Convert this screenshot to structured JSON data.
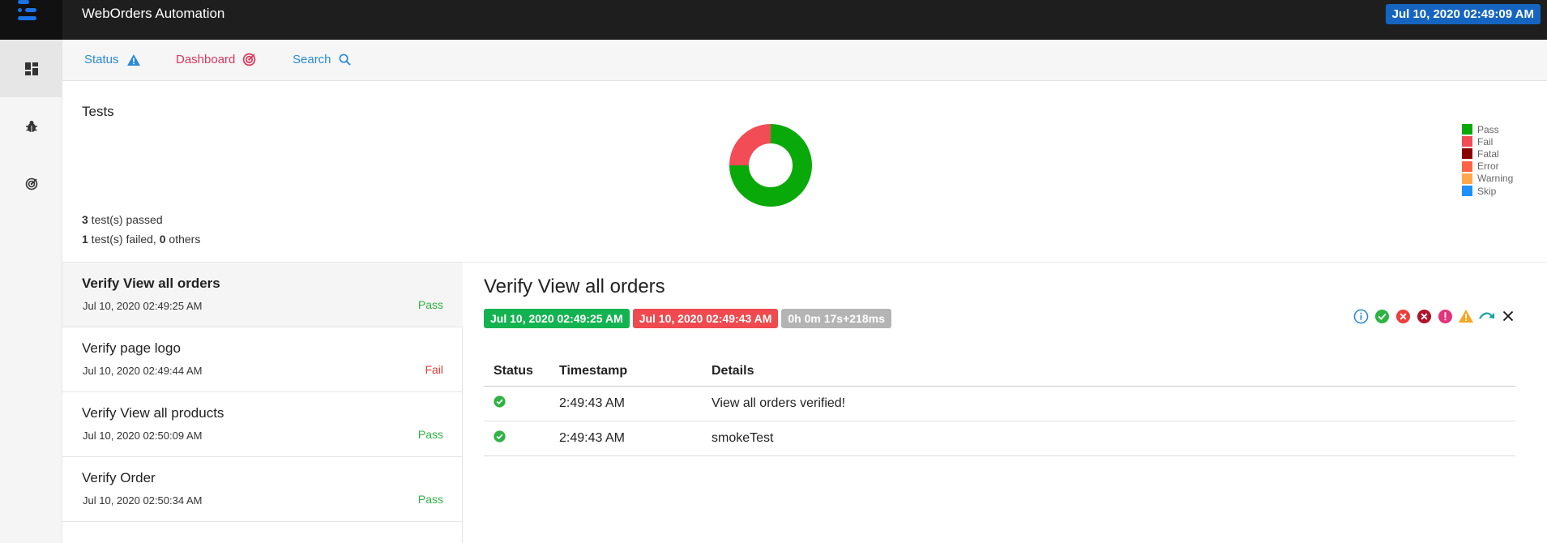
{
  "header": {
    "app_title": "WebOrders Automation",
    "datetime": "Jul 10, 2020 02:49:09 AM"
  },
  "sidebar": {
    "items": [
      {
        "icon": "dashboard-grid-icon"
      },
      {
        "icon": "bug-icon"
      },
      {
        "icon": "radar-icon"
      }
    ]
  },
  "nav": {
    "status_label": "Status",
    "dashboard_label": "Dashboard",
    "search_label": "Search"
  },
  "summary": {
    "title": "Tests",
    "passed_count": "3",
    "passed_text": " test(s) passed",
    "failed_count": "1",
    "failed_text": " test(s) failed, ",
    "others_count": "0",
    "others_text": " others"
  },
  "chart_data": {
    "type": "pie",
    "donut": true,
    "slices": [
      {
        "label": "Pass",
        "value": 3,
        "color": "#0aa90a"
      },
      {
        "label": "Fail",
        "value": 1,
        "color": "#f24c56"
      },
      {
        "label": "Fatal",
        "value": 0,
        "color": "#8b0000"
      },
      {
        "label": "Error",
        "value": 0,
        "color": "#ff6347"
      },
      {
        "label": "Warning",
        "value": 0,
        "color": "#ffa64d"
      },
      {
        "label": "Skip",
        "value": 0,
        "color": "#1e90ff"
      }
    ],
    "legend_position": "top-right"
  },
  "tests": [
    {
      "name": "Verify View all orders",
      "time": "Jul 10, 2020 02:49:25 AM",
      "status": "Pass"
    },
    {
      "name": "Verify page logo",
      "time": "Jul 10, 2020 02:49:44 AM",
      "status": "Fail"
    },
    {
      "name": "Verify View all products",
      "time": "Jul 10, 2020 02:50:09 AM",
      "status": "Pass"
    },
    {
      "name": "Verify Order",
      "time": "Jul 10, 2020 02:50:34 AM",
      "status": "Pass"
    }
  ],
  "detail": {
    "title": "Verify View all orders",
    "start_time": "Jul 10, 2020 02:49:25 AM",
    "end_time": "Jul 10, 2020 02:49:43 AM",
    "duration": "0h 0m 17s+218ms",
    "filter_icons": [
      "info-icon",
      "pass-icon",
      "fail-icon",
      "fatal-icon",
      "error-icon",
      "warning-icon",
      "skip-icon",
      "clear-filter-icon"
    ],
    "log_headers": [
      "Status",
      "Timestamp",
      "Details"
    ],
    "log_rows": [
      {
        "status_icon": "pass-check-icon",
        "timestamp": "2:49:43 AM",
        "details": "View all orders verified!"
      },
      {
        "status_icon": "pass-check-icon",
        "timestamp": "2:49:43 AM",
        "details": "smokeTest"
      }
    ]
  }
}
